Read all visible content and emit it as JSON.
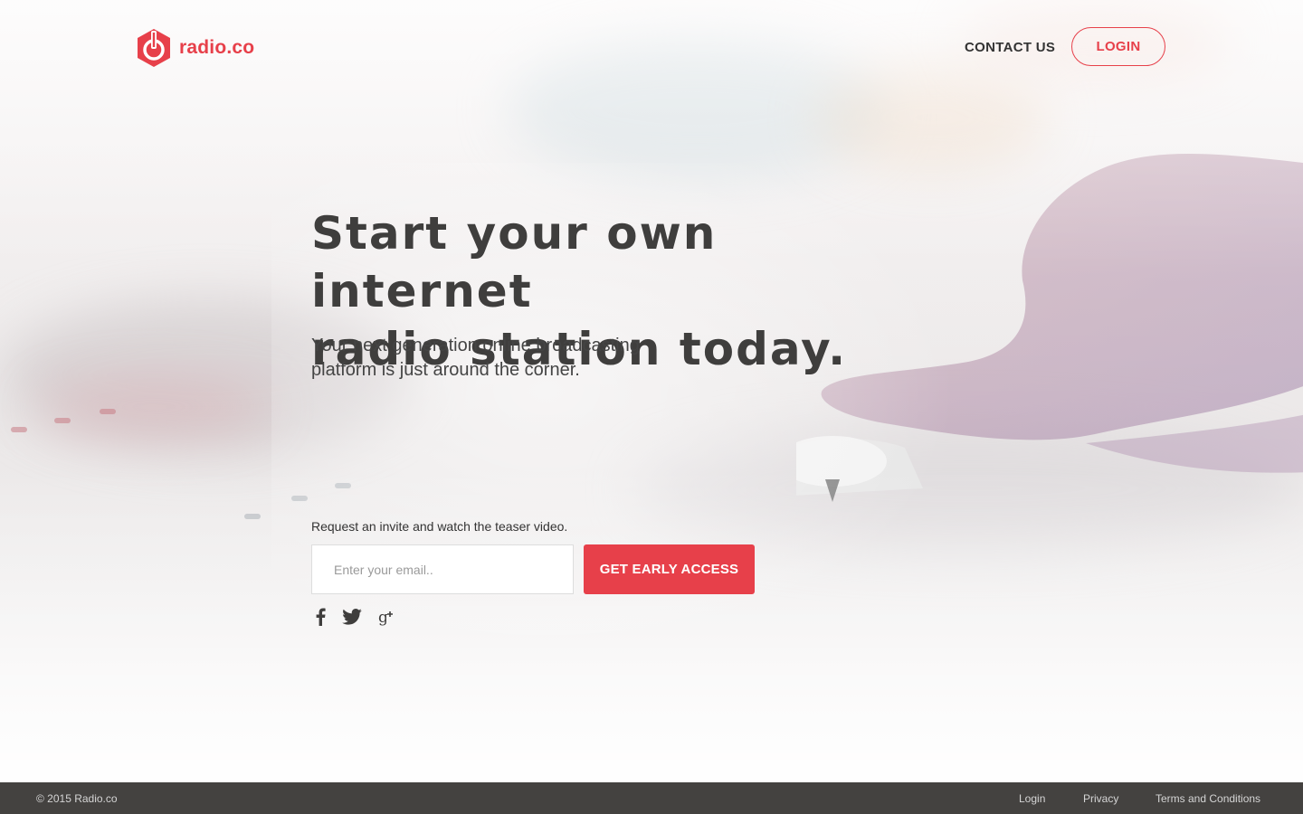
{
  "header": {
    "logo_text": "radio.co",
    "nav": {
      "contact_label": "CONTACT US",
      "login_label": "LOGIN"
    }
  },
  "hero": {
    "headline_line1": "Start your own internet",
    "headline_line2": "radio station today.",
    "subheadline_line1": "Your next generation online broadcasting",
    "subheadline_line2": "platform is just around the corner."
  },
  "signup": {
    "invite_text": "Request an invite and watch the teaser video.",
    "email_placeholder": "Enter your email..",
    "email_value": "",
    "cta_label": "GET EARLY ACCESS"
  },
  "social": {
    "icons": [
      "facebook-icon",
      "twitter-icon",
      "google-plus-icon"
    ]
  },
  "footer": {
    "copyright": "© 2015 Radio.co",
    "links": {
      "login": "Login",
      "privacy": "Privacy",
      "terms": "Terms and Conditions"
    }
  },
  "colors": {
    "brand": "#e7404a",
    "text": "#3f3e3d",
    "footer_bg": "#444240"
  }
}
